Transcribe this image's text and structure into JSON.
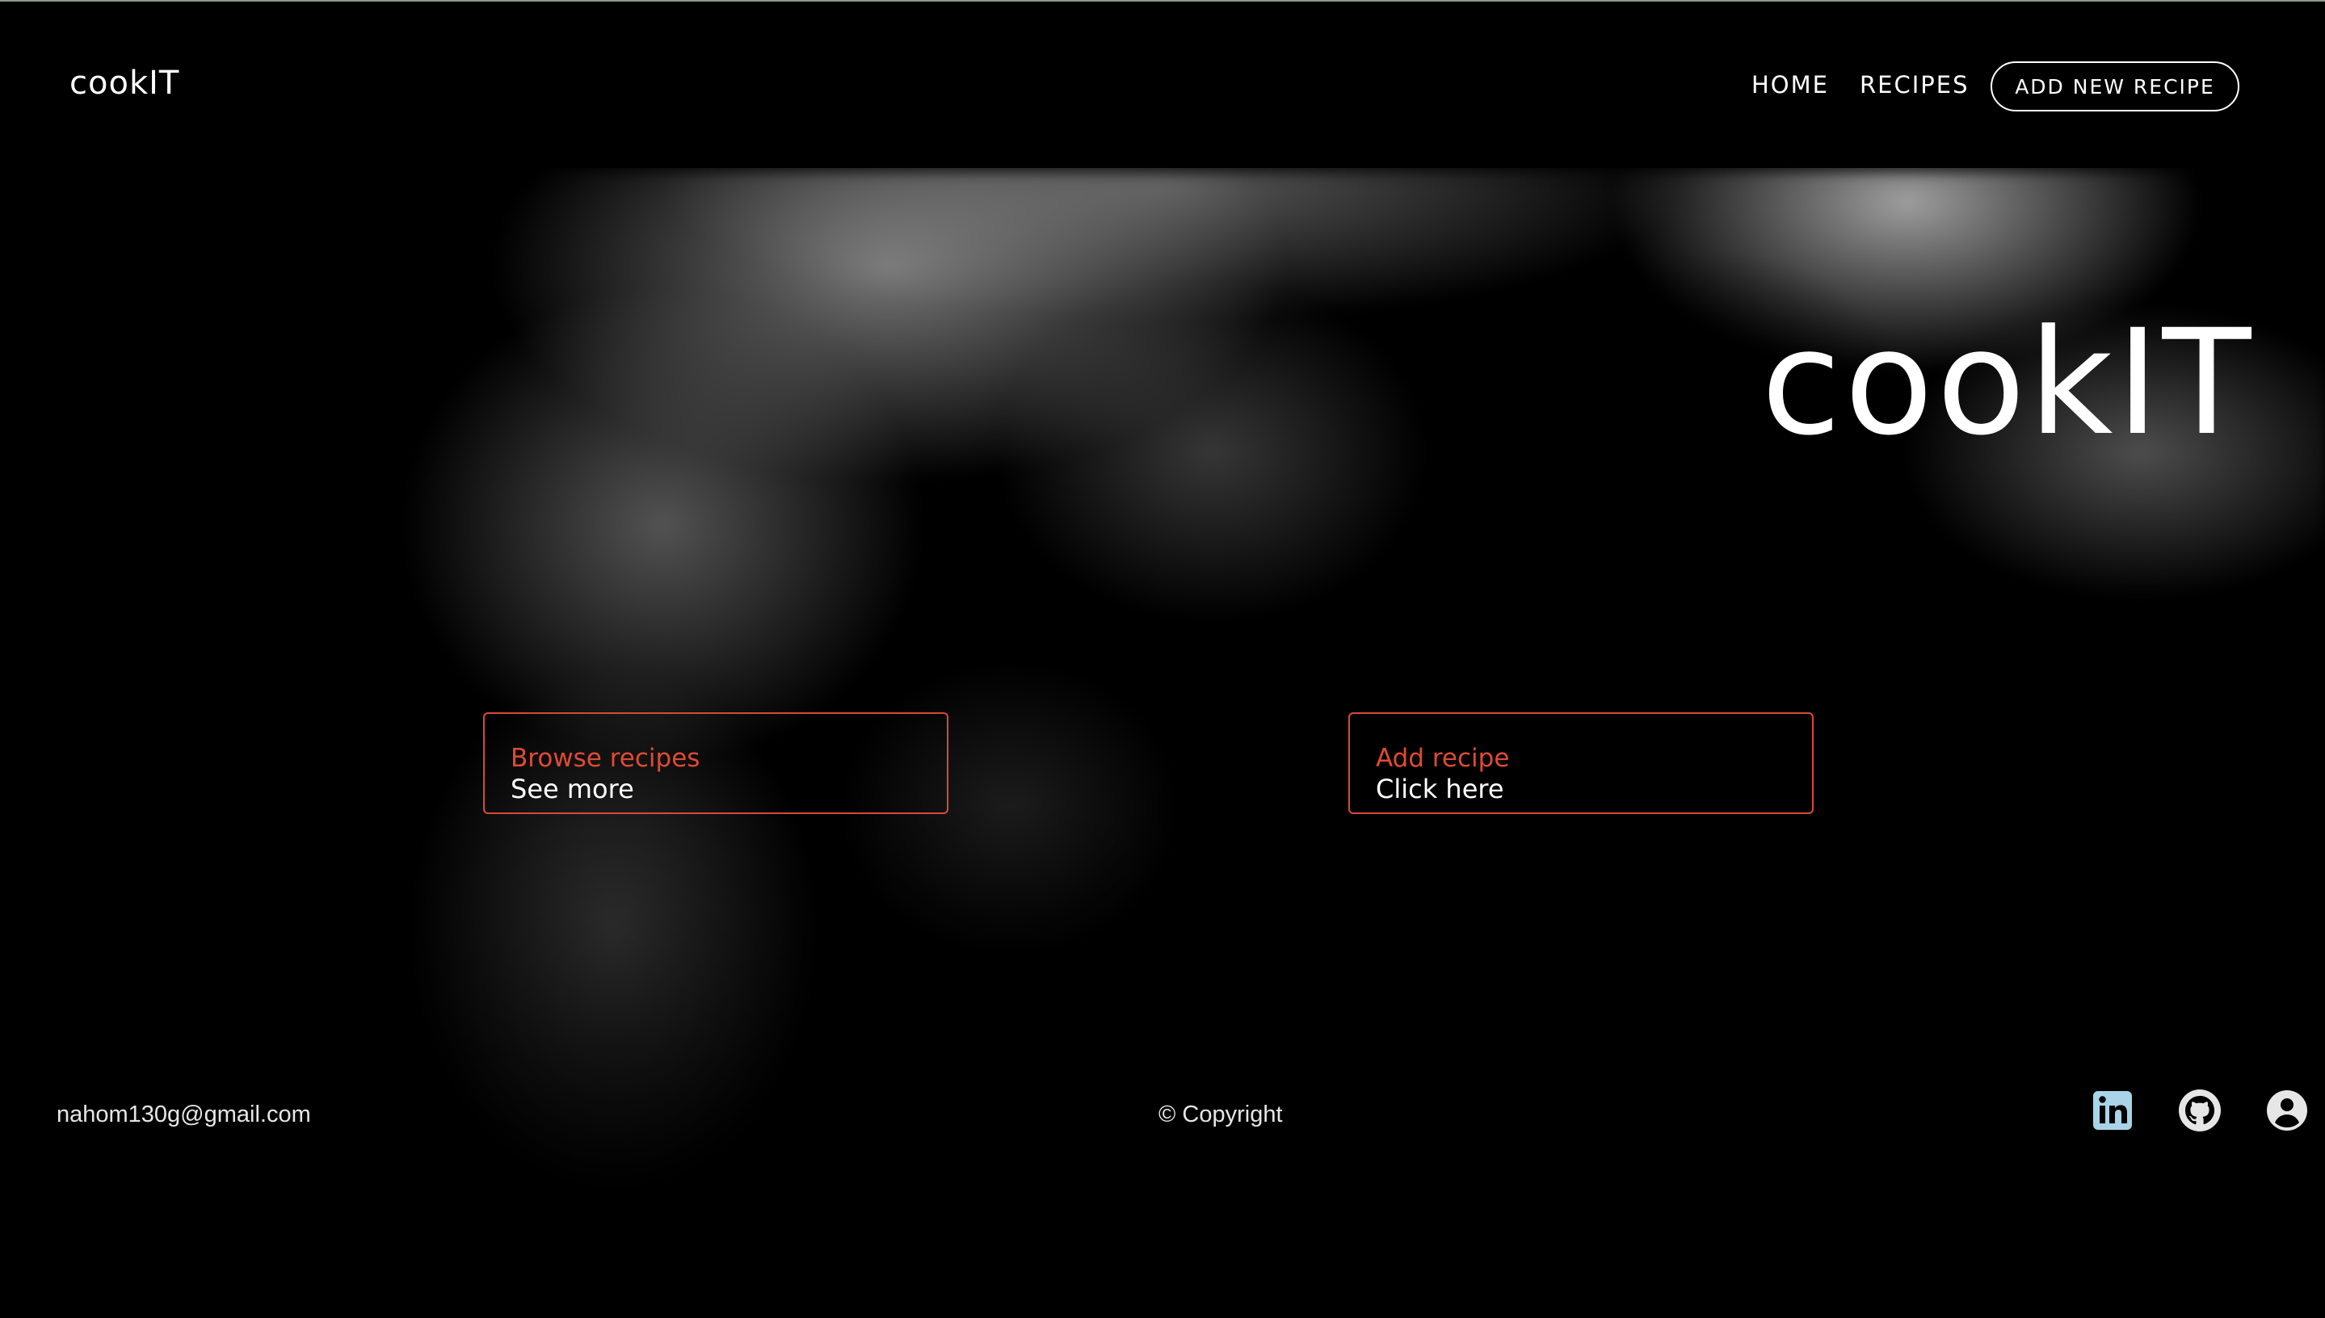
{
  "navbar": {
    "brand": "cookIT",
    "links": {
      "home": "HOME",
      "recipes": "RECIPES",
      "add_new": "ADD NEW RECIPE"
    }
  },
  "hero": {
    "title": "cookIT"
  },
  "cards": {
    "browse": {
      "title": "Browse recipes",
      "subtitle": "See more"
    },
    "add": {
      "title": "Add recipe",
      "subtitle": "Click here"
    }
  },
  "footer": {
    "email": "nahom130g@gmail.com",
    "copyright": "© Copyright",
    "social_icons": [
      "linkedin-icon",
      "github-icon",
      "user-icon"
    ]
  },
  "colors": {
    "accent": "#e04a33",
    "background": "#000000",
    "text": "#ffffff",
    "linkedin_icon": "#a9d4e8"
  }
}
